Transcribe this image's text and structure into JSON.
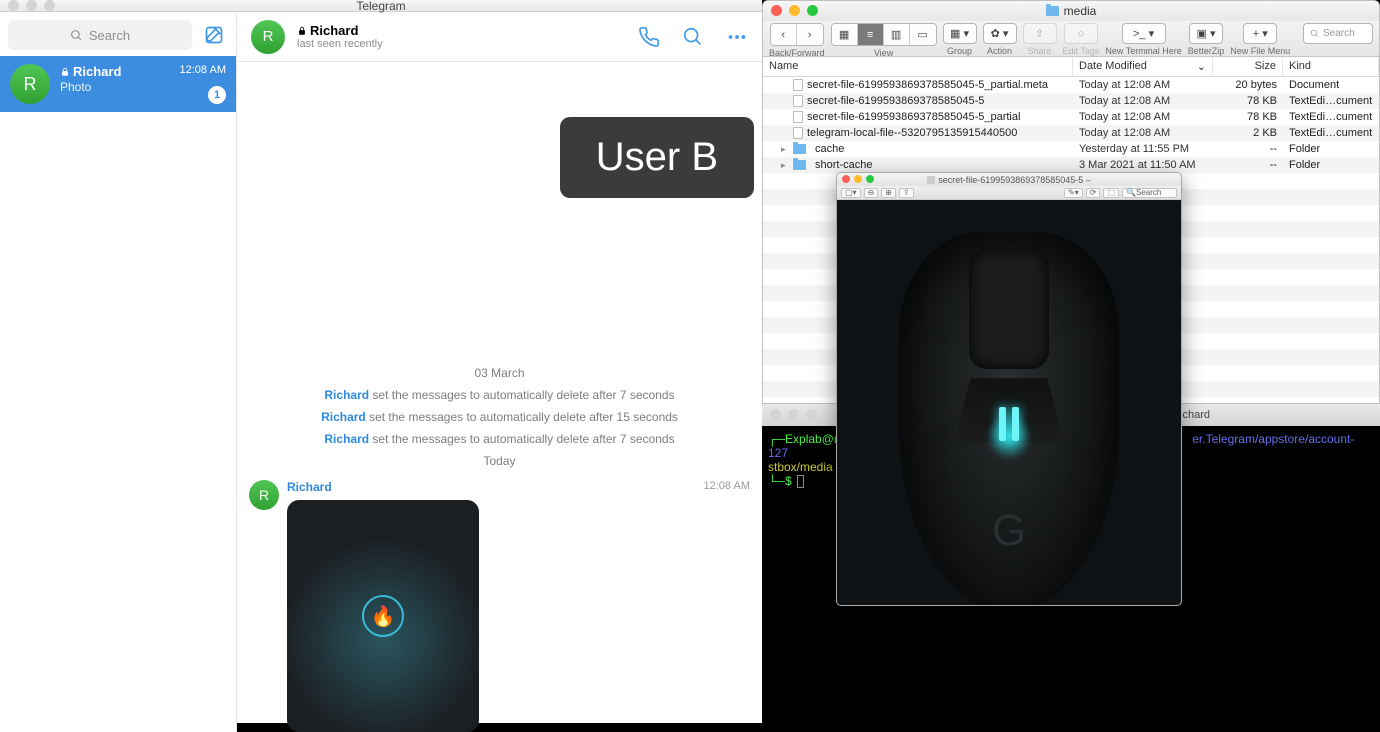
{
  "telegram": {
    "window_title": "Telegram",
    "search_placeholder": "Search",
    "chats": [
      {
        "name": "Richard",
        "preview": "Photo",
        "time": "12:08 AM",
        "unread": "1"
      }
    ],
    "header": {
      "name": "Richard",
      "status": "last seen recently"
    },
    "overlay_label": "User B",
    "date_label_1": "03 March",
    "service_messages": [
      {
        "name": "Richard",
        "text": " set the messages to automatically delete after 7 seconds"
      },
      {
        "name": "Richard",
        "text": " set the messages to automatically delete after 15 seconds"
      },
      {
        "name": "Richard",
        "text": " set the messages to automatically delete after 7 seconds"
      }
    ],
    "date_label_2": "Today",
    "message": {
      "sender": "Richard",
      "time": "12:08 AM"
    }
  },
  "finder": {
    "window_title": "media",
    "toolbar_labels": {
      "back_forward": "Back/Forward",
      "view": "View",
      "group": "Group",
      "action": "Action",
      "share": "Share",
      "edit_tags": "Edit Tags",
      "new_terminal": "New Terminal Here",
      "betterzip": "BetterZip",
      "new_file_menu": "New File Menu"
    },
    "search_placeholder": "Search",
    "columns": {
      "name": "Name",
      "date": "Date Modified",
      "size": "Size",
      "kind": "Kind"
    },
    "rows": [
      {
        "name": "secret-file-6199593869378585045-5_partial.meta",
        "date": "Today at 12:08 AM",
        "size": "20 bytes",
        "kind": "Document",
        "type": "file"
      },
      {
        "name": "secret-file-6199593869378585045-5",
        "date": "Today at 12:08 AM",
        "size": "78 KB",
        "kind": "TextEdi…cument",
        "type": "file"
      },
      {
        "name": "secret-file-6199593869378585045-5_partial",
        "date": "Today at 12:08 AM",
        "size": "78 KB",
        "kind": "TextEdi…cument",
        "type": "file"
      },
      {
        "name": "telegram-local-file--5320795135915440500",
        "date": "Today at 12:08 AM",
        "size": "2 KB",
        "kind": "TextEdi…cument",
        "type": "file"
      },
      {
        "name": "cache",
        "date": "Yesterday at 11:55 PM",
        "size": "--",
        "kind": "Folder",
        "type": "folder"
      },
      {
        "name": "short-cache",
        "date": "3 Mar 2021 at 11:50 AM",
        "size": "--",
        "kind": "Folder",
        "type": "folder"
      }
    ]
  },
  "terminal": {
    "title_right": "Richard",
    "line1_a": "Explab@ri",
    "line1_b": "er.Telegram/appstore/account-127",
    "line2": "stbox/media",
    "prompt": "└─$"
  },
  "preview": {
    "title": "secret-file-6199593869378585045-5 –",
    "search_placeholder": "Search",
    "logo_text": "G"
  }
}
